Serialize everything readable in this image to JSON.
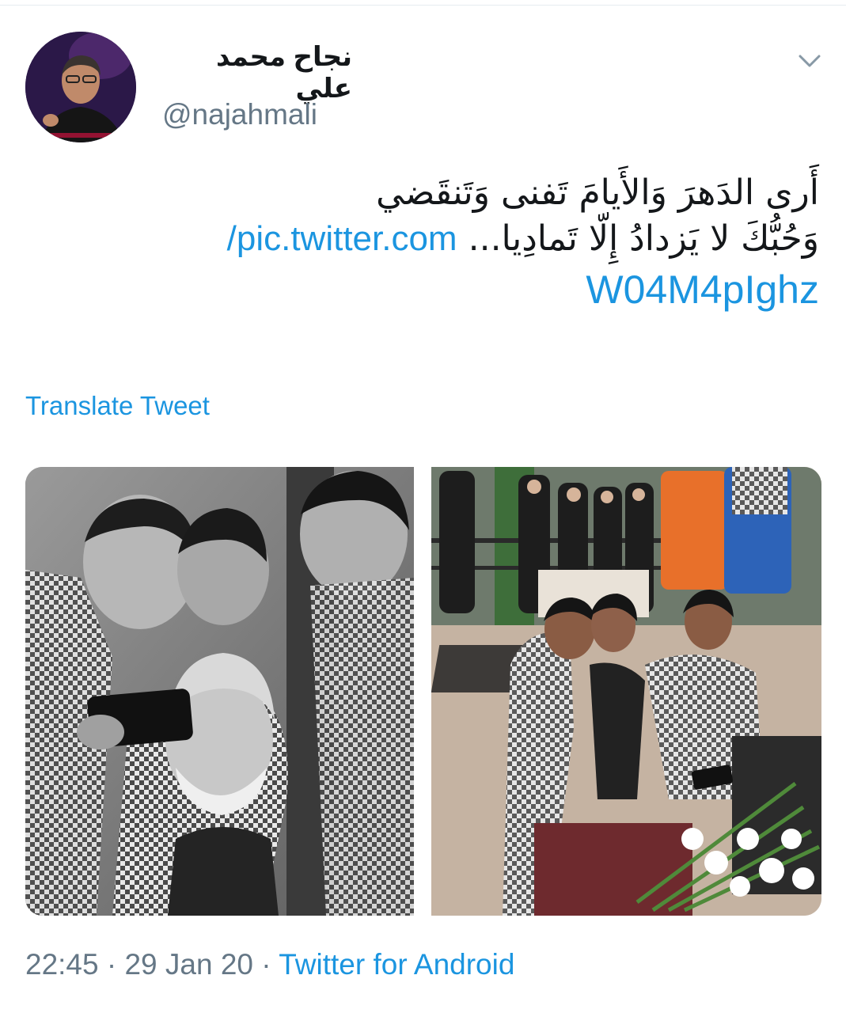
{
  "tweet": {
    "display_name": "نجاح محمد علي",
    "handle": "@najahmali",
    "menu_icon": "chevron-down-icon",
    "text_line1": "أَرى الدَهرَ وَالأَيامَ تَفنى وَتَنقَضي",
    "text_line2": "وَحُبُّكَ لا يَزدادُ إِلّا تَمادِيا...",
    "link_part1": "pic.twitter.com/",
    "link_part2": "W04M4pIghz",
    "translate_label": "Translate Tweet",
    "time": "22:45",
    "separator": "·",
    "date": "29 Jan 20",
    "source": "Twitter for Android"
  },
  "colors": {
    "link": "#1b95e0",
    "secondary_text": "#657786",
    "primary_text": "#14171a"
  }
}
